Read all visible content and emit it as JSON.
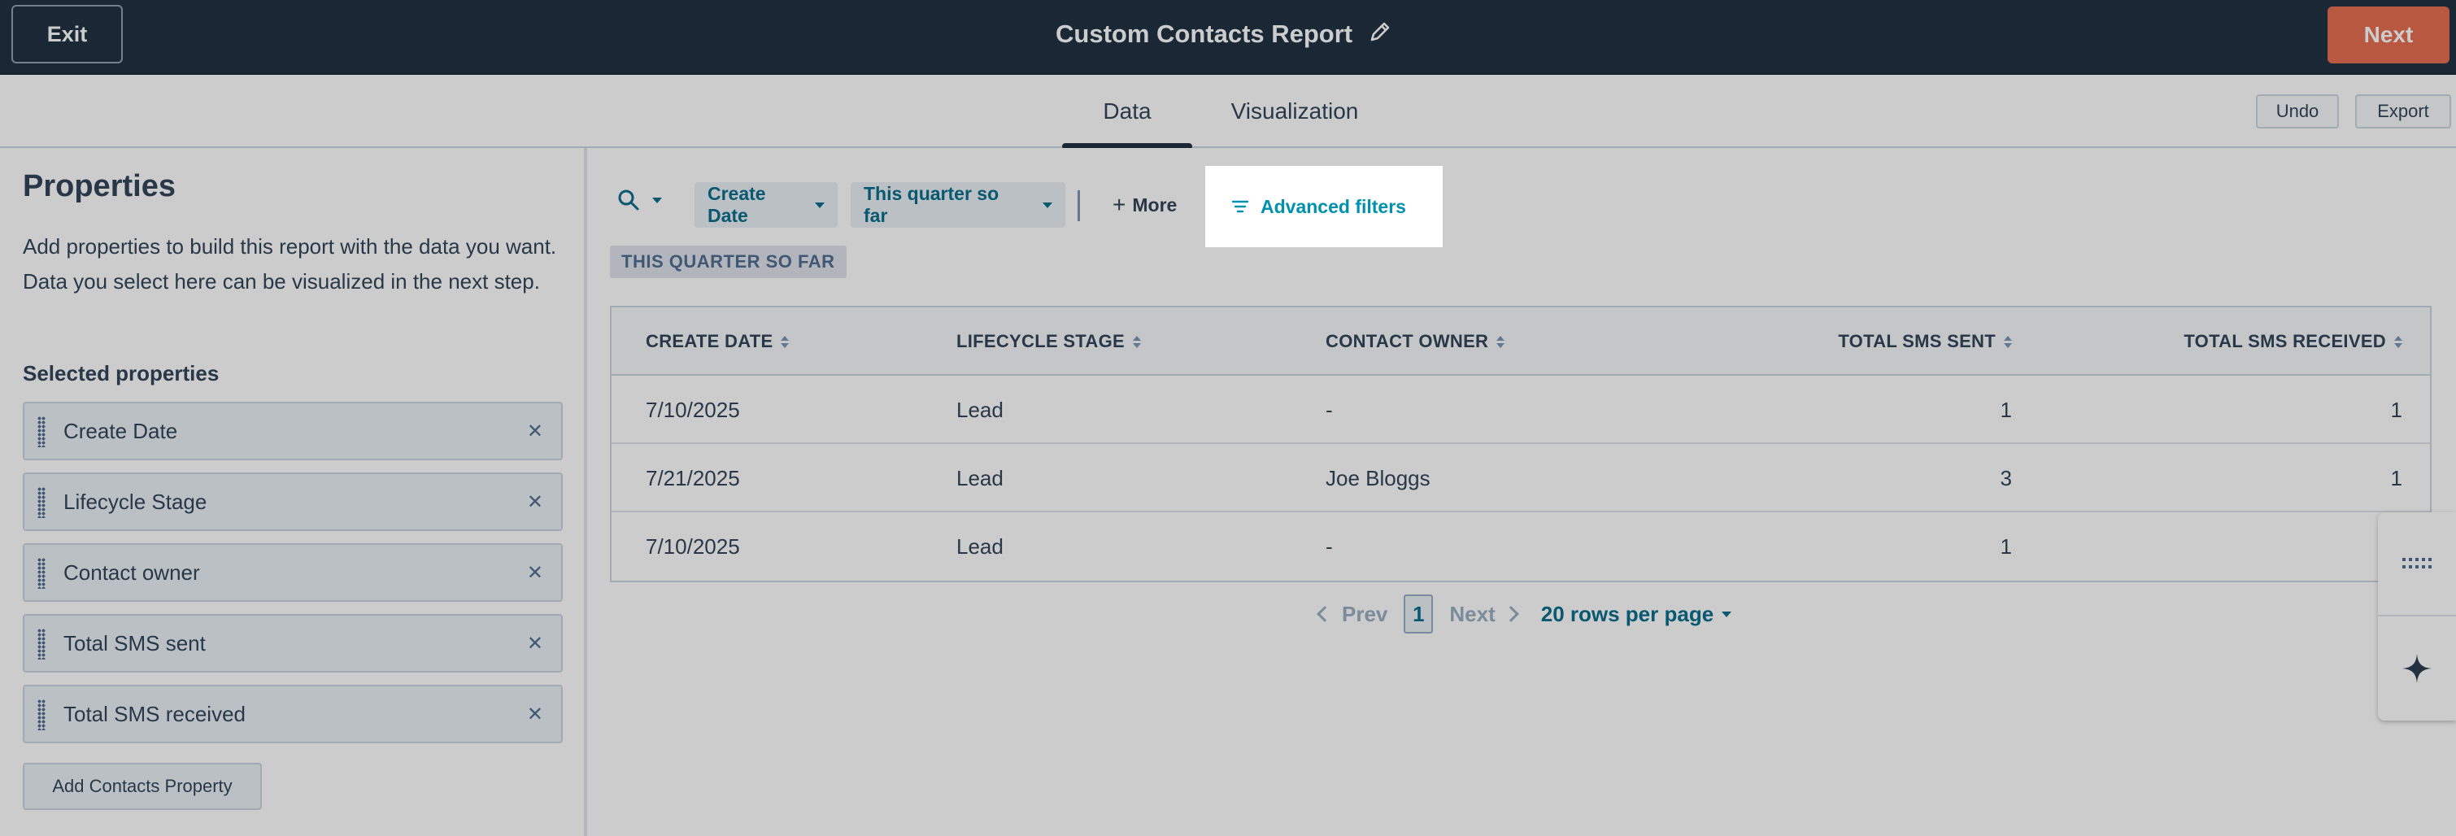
{
  "header": {
    "exit_label": "Exit",
    "title": "Custom Contacts Report",
    "next_label": "Next"
  },
  "tabs": [
    {
      "label": "Data",
      "active": true
    },
    {
      "label": "Visualization",
      "active": false
    }
  ],
  "toolbar": {
    "undo_label": "Undo",
    "export_label": "Export"
  },
  "properties_panel": {
    "title": "Properties",
    "description": "Add properties to build this report with the data you want. Data you select here can be visualized in the next step.",
    "selected_title": "Selected properties",
    "items": [
      {
        "label": "Create Date"
      },
      {
        "label": "Lifecycle Stage"
      },
      {
        "label": "Contact owner"
      },
      {
        "label": "Total SMS sent"
      },
      {
        "label": "Total SMS received"
      }
    ],
    "add_label": "Add Contacts Property"
  },
  "filters": {
    "create_date_label": "Create Date",
    "quarter_label": "This quarter so far",
    "more_label": "More",
    "advanced_label": "Advanced filters",
    "active_tag": "THIS QUARTER SO FAR"
  },
  "table": {
    "columns": [
      "CREATE DATE",
      "LIFECYCLE STAGE",
      "CONTACT OWNER",
      "TOTAL SMS SENT",
      "TOTAL SMS RECEIVED"
    ],
    "rows": [
      [
        "7/10/2025",
        "Lead",
        "-",
        "1",
        "1"
      ],
      [
        "7/21/2025",
        "Lead",
        "Joe Bloggs",
        "3",
        "1"
      ],
      [
        "7/10/2025",
        "Lead",
        "-",
        "1",
        ""
      ]
    ]
  },
  "pagination": {
    "prev_label": "Prev",
    "current_page": "1",
    "next_label": "Next",
    "rows_per_page_label": "20 rows per page"
  },
  "colors": {
    "header_bg": "#213343",
    "next_button": "#e66e50",
    "link": "#0091ae",
    "chip_bg": "#eaf0f6"
  }
}
